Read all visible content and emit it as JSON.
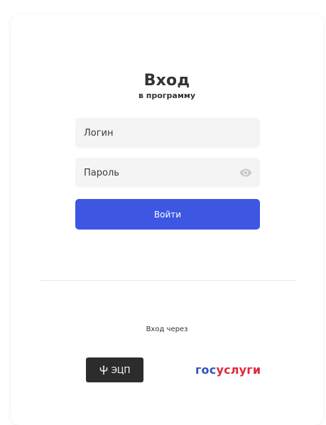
{
  "header": {
    "title": "Вход",
    "subtitle": "в программу"
  },
  "form": {
    "login": {
      "placeholder": "Логин",
      "value": ""
    },
    "password": {
      "placeholder": "Пароль",
      "value": "",
      "toggle_icon": "eye-icon"
    },
    "submit_label": "Войти"
  },
  "alt_login": {
    "label": "Вход через",
    "ecp": {
      "label": "ЭЦП",
      "icon": "usb-icon"
    },
    "gosuslugi": {
      "part1": "гос",
      "part2": "услуги"
    }
  },
  "colors": {
    "primary": "#3d57e3",
    "ecp_bg": "#2c2c2c",
    "gos_blue": "#2855b8",
    "gos_red": "#e0283a",
    "input_bg": "#f4f4f4"
  }
}
